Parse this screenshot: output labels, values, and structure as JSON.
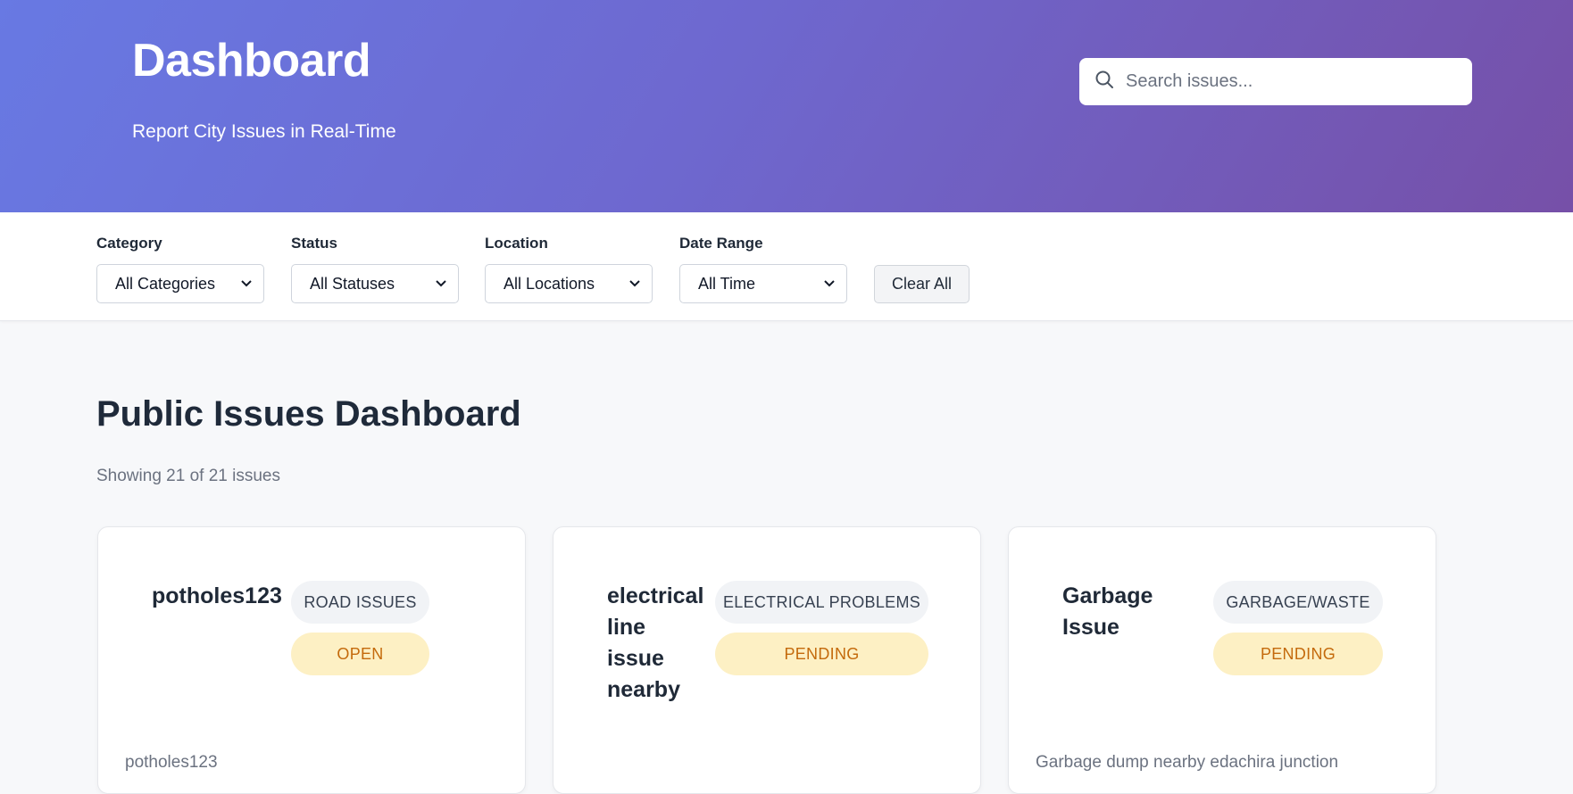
{
  "header": {
    "title": "Dashboard",
    "subtitle": "Report City Issues in Real-Time",
    "search_placeholder": "Search issues..."
  },
  "filters": {
    "category": {
      "label": "Category",
      "value": "All Categories"
    },
    "status": {
      "label": "Status",
      "value": "All Statuses"
    },
    "location": {
      "label": "Location",
      "value": "All Locations"
    },
    "date_range": {
      "label": "Date Range",
      "value": "All Time"
    },
    "clear_label": "Clear All"
  },
  "main": {
    "title": "Public Issues Dashboard",
    "count_text": "Showing 21 of 21 issues"
  },
  "issues": [
    {
      "title": "potholes123",
      "category": "ROAD ISSUES",
      "status": "OPEN",
      "description": "potholes123"
    },
    {
      "title": "electrical line issue nearby",
      "category": "ELECTRICAL PROBLEMS",
      "status": "PENDING",
      "description": ""
    },
    {
      "title": "Garbage Issue",
      "category": "GARBAGE/WASTE",
      "status": "PENDING",
      "description": "Garbage dump nearby edachira junction"
    }
  ],
  "colors": {
    "header_gradient_start": "#6879e3",
    "header_gradient_end": "#7650a8",
    "status_badge_bg": "#fdf0c4",
    "status_badge_text": "#c46a0c",
    "category_badge_bg": "#f1f3f6"
  }
}
